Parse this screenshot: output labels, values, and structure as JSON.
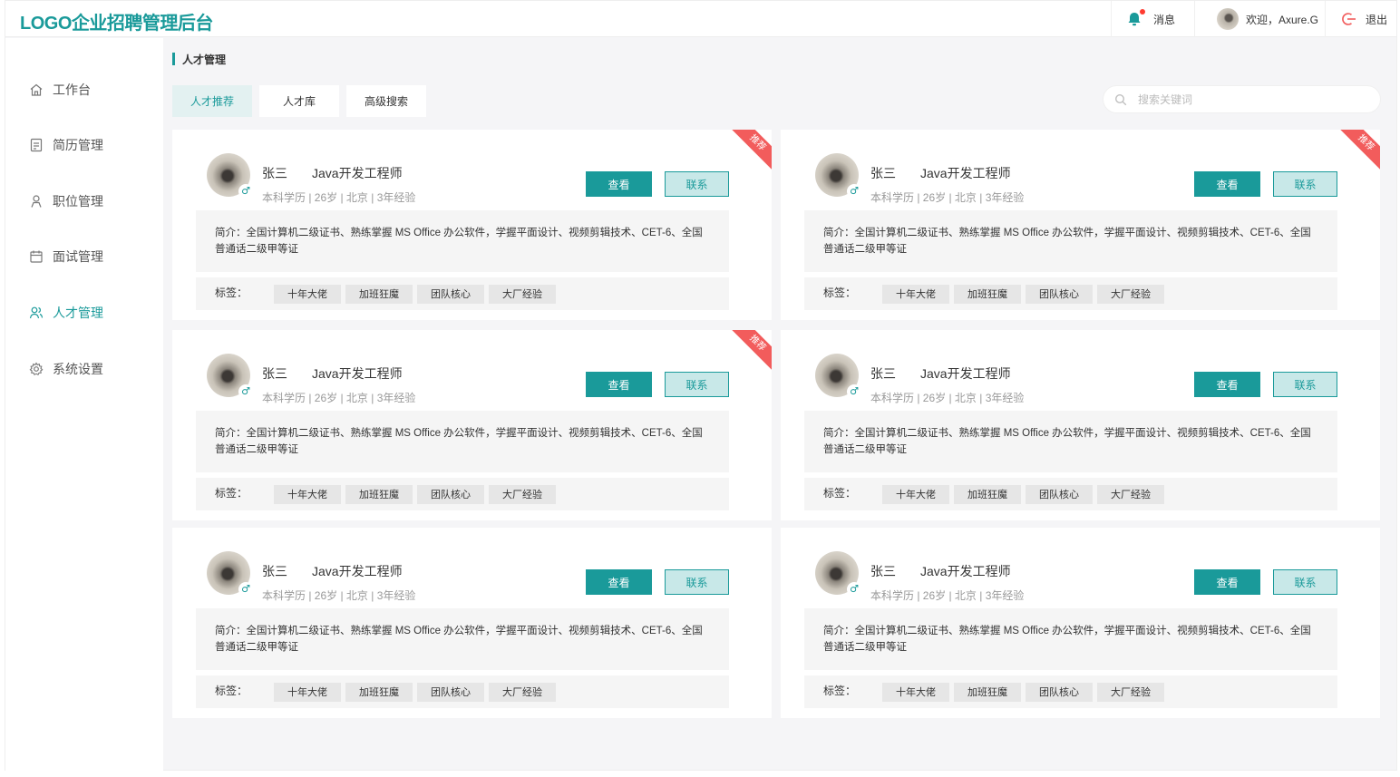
{
  "header": {
    "logo": "LOGO企业招聘管理后台",
    "message": "消息",
    "welcome": "欢迎，Axure.G",
    "logout": "退出"
  },
  "sidebar": {
    "items": [
      {
        "label": "工作台",
        "icon": "home-icon"
      },
      {
        "label": "简历管理",
        "icon": "resume-icon"
      },
      {
        "label": "职位管理",
        "icon": "person-icon"
      },
      {
        "label": "面试管理",
        "icon": "calendar-icon"
      },
      {
        "label": "人才管理",
        "icon": "users-icon",
        "active": true
      },
      {
        "label": "系统设置",
        "icon": "gear-icon"
      }
    ]
  },
  "breadcrumb": "人才管理",
  "tabs": [
    {
      "label": "人才推荐",
      "active": true
    },
    {
      "label": "人才库"
    },
    {
      "label": "高级搜索"
    }
  ],
  "search": {
    "placeholder": "搜索关键词"
  },
  "colors": {
    "accent": "#1a9a9a",
    "ribbon": "#f25c5c"
  },
  "cards": [
    {
      "recommended": true,
      "ribbon": "推荐",
      "gender": "♂",
      "name": "张三",
      "job": "Java开发工程师",
      "meta": "本科学历 | 26岁 | 北京 | 3年经验",
      "view": "查看",
      "contact": "联系",
      "intro": "简介：全国计算机二级证书、熟练掌握 MS Office 办公软件，学握平面设计、视频剪辑技术、CET-6、全国普通话二级甲等证",
      "tags_label": "标签：",
      "tags": [
        "十年大佬",
        "加班狂魔",
        "团队核心",
        "大厂经验"
      ]
    },
    {
      "recommended": true,
      "ribbon": "推荐",
      "gender": "♂",
      "name": "张三",
      "job": "Java开发工程师",
      "meta": "本科学历 | 26岁 | 北京 | 3年经验",
      "view": "查看",
      "contact": "联系",
      "intro": "简介：全国计算机二级证书、熟练掌握 MS Office 办公软件，学握平面设计、视频剪辑技术、CET-6、全国普通话二级甲等证",
      "tags_label": "标签：",
      "tags": [
        "十年大佬",
        "加班狂魔",
        "团队核心",
        "大厂经验"
      ]
    },
    {
      "recommended": true,
      "ribbon": "推荐",
      "gender": "♂",
      "name": "张三",
      "job": "Java开发工程师",
      "meta": "本科学历 | 26岁 | 北京 | 3年经验",
      "view": "查看",
      "contact": "联系",
      "intro": "简介：全国计算机二级证书、熟练掌握 MS Office 办公软件，学握平面设计、视频剪辑技术、CET-6、全国普通话二级甲等证",
      "tags_label": "标签：",
      "tags": [
        "十年大佬",
        "加班狂魔",
        "团队核心",
        "大厂经验"
      ]
    },
    {
      "recommended": false,
      "gender": "♂",
      "name": "张三",
      "job": "Java开发工程师",
      "meta": "本科学历 | 26岁 | 北京 | 3年经验",
      "view": "查看",
      "contact": "联系",
      "intro": "简介：全国计算机二级证书、熟练掌握 MS Office 办公软件，学握平面设计、视频剪辑技术、CET-6、全国普通话二级甲等证",
      "tags_label": "标签：",
      "tags": [
        "十年大佬",
        "加班狂魔",
        "团队核心",
        "大厂经验"
      ]
    },
    {
      "recommended": false,
      "gender": "♂",
      "name": "张三",
      "job": "Java开发工程师",
      "meta": "本科学历 | 26岁 | 北京 | 3年经验",
      "view": "查看",
      "contact": "联系",
      "intro": "简介：全国计算机二级证书、熟练掌握 MS Office 办公软件，学握平面设计、视频剪辑技术、CET-6、全国普通话二级甲等证",
      "tags_label": "标签：",
      "tags": [
        "十年大佬",
        "加班狂魔",
        "团队核心",
        "大厂经验"
      ]
    },
    {
      "recommended": false,
      "gender": "♂",
      "name": "张三",
      "job": "Java开发工程师",
      "meta": "本科学历 | 26岁 | 北京 | 3年经验",
      "view": "查看",
      "contact": "联系",
      "intro": "简介：全国计算机二级证书、熟练掌握 MS Office 办公软件，学握平面设计、视频剪辑技术、CET-6、全国普通话二级甲等证",
      "tags_label": "标签：",
      "tags": [
        "十年大佬",
        "加班狂魔",
        "团队核心",
        "大厂经验"
      ]
    }
  ]
}
